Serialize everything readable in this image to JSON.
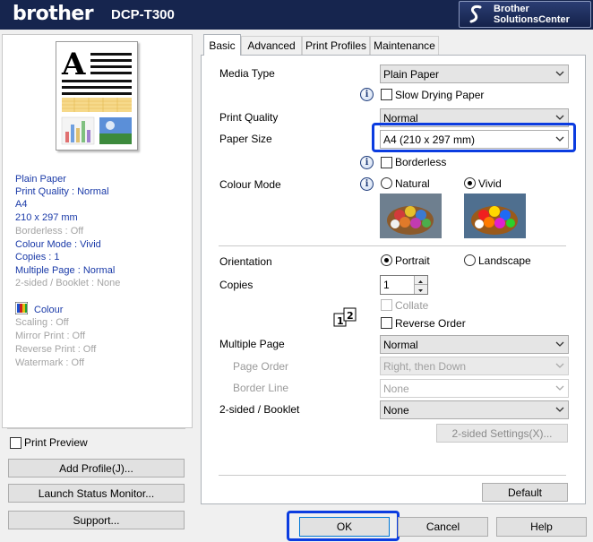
{
  "header": {
    "brand": "brother",
    "model": "DCP-T300",
    "solutions_line1": "Brother",
    "solutions_line2": "SolutionsCenter"
  },
  "left": {
    "summary": [
      {
        "text": "Plain Paper",
        "style": "blue"
      },
      {
        "text": "Print Quality : Normal",
        "style": "blue"
      },
      {
        "text": "A4",
        "style": "blue"
      },
      {
        "text": "210 x 297 mm",
        "style": "blue"
      },
      {
        "text": "Borderless : Off",
        "style": "gray"
      },
      {
        "text": "Colour Mode : Vivid",
        "style": "blue"
      },
      {
        "text": "Copies : 1",
        "style": "blue"
      },
      {
        "text": "Multiple Page : Normal",
        "style": "blue"
      },
      {
        "text": "2-sided / Booklet : None",
        "style": "gray"
      }
    ],
    "colour_label": "Colour",
    "summary2": [
      "Scaling : Off",
      "Mirror Print : Off",
      "Reverse Print : Off",
      "Watermark : Off"
    ],
    "print_preview_label": "Print Preview",
    "add_profile_label": "Add Profile(J)...",
    "launch_status_label": "Launch Status Monitor...",
    "support_label": "Support..."
  },
  "tabs": [
    "Basic",
    "Advanced",
    "Print Profiles",
    "Maintenance"
  ],
  "basic": {
    "media_type_label": "Media Type",
    "media_type_value": "Plain Paper",
    "slow_drying_label": "Slow Drying Paper",
    "print_quality_label": "Print Quality",
    "print_quality_value": "Normal",
    "paper_size_label": "Paper Size",
    "paper_size_value": "A4 (210 x 297 mm)",
    "borderless_label": "Borderless",
    "colour_mode_label": "Colour Mode",
    "natural_label": "Natural",
    "vivid_label": "Vivid",
    "orientation_label": "Orientation",
    "portrait_label": "Portrait",
    "landscape_label": "Landscape",
    "copies_label": "Copies",
    "copies_value": "1",
    "collate_label": "Collate",
    "reverse_order_label": "Reverse Order",
    "multiple_page_label": "Multiple Page",
    "multiple_page_value": "Normal",
    "page_order_label": "Page Order",
    "page_order_value": "Right, then Down",
    "border_line_label": "Border Line",
    "border_line_value": "None",
    "two_sided_label": "2-sided / Booklet",
    "two_sided_value": "None",
    "two_sided_settings_label": "2-sided Settings(X)...",
    "default_label": "Default",
    "order_icon_text": "1|2",
    "info_glyph": "i"
  },
  "footer": {
    "ok_label": "OK",
    "cancel_label": "Cancel",
    "help_label": "Help"
  },
  "colors": {
    "header_bg": "#16254e",
    "highlight": "#0b3ce0",
    "summary_blue": "#1a3aa8",
    "summary_gray": "#a4a4a4"
  }
}
